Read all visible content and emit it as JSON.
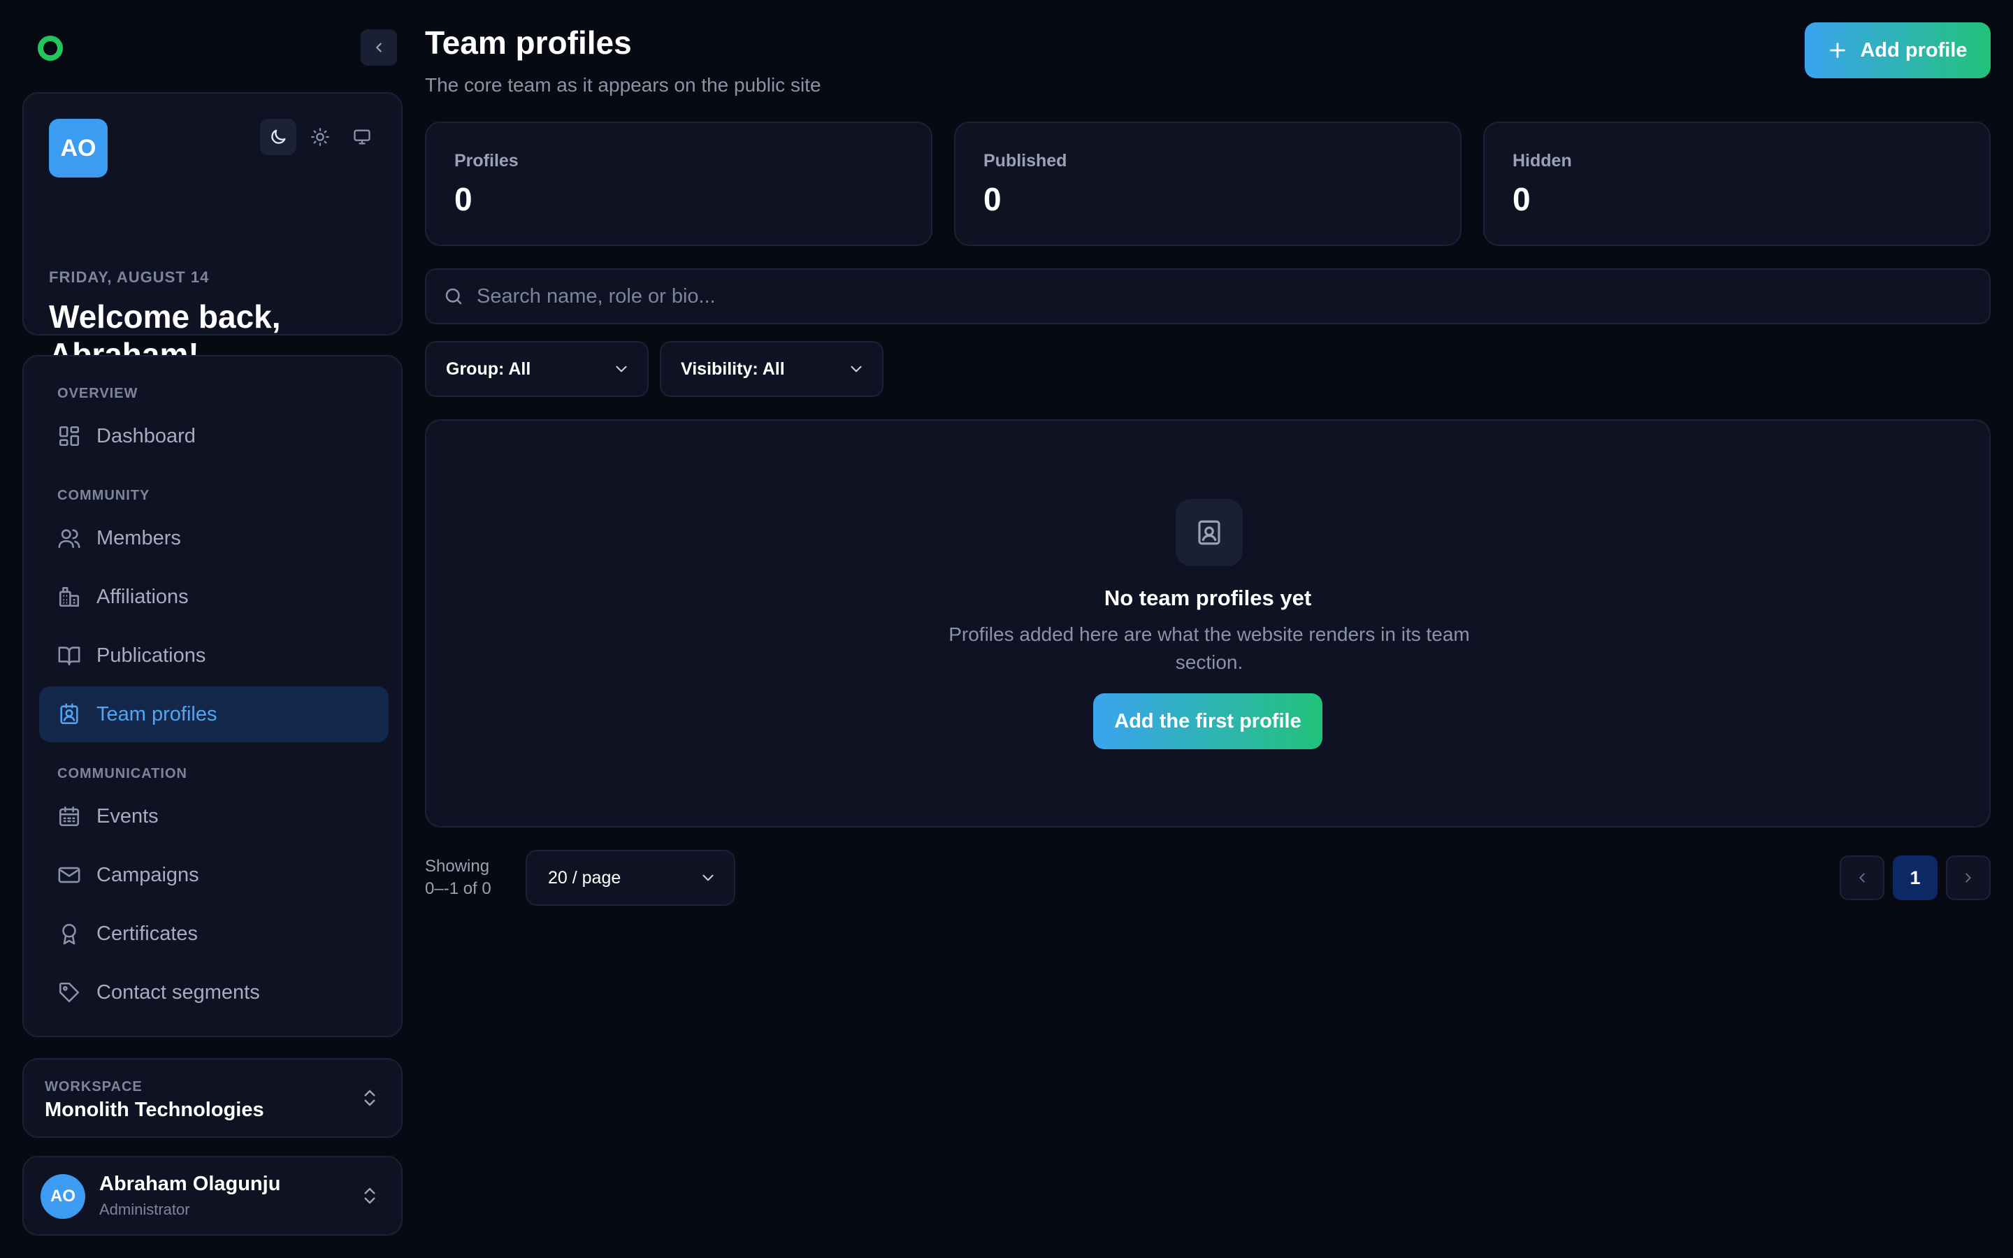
{
  "sidebar": {
    "profile": {
      "initials": "AO",
      "date": "FRIDAY, AUGUST 14",
      "greeting": "Welcome back, Abraham!"
    },
    "sections": {
      "overview": "OVERVIEW",
      "community": "COMMUNITY",
      "communication": "COMMUNICATION"
    },
    "items": {
      "dashboard": "Dashboard",
      "members": "Members",
      "affiliations": "Affiliations",
      "publications": "Publications",
      "team_profiles": "Team profiles",
      "events": "Events",
      "campaigns": "Campaigns",
      "certificates": "Certificates",
      "contact_segments": "Contact segments"
    },
    "workspace": {
      "label": "WORKSPACE",
      "name": "Monolith Technologies"
    },
    "user": {
      "initials": "AO",
      "name": "Abraham Olagunju",
      "role": "Administrator"
    }
  },
  "header": {
    "title": "Team profiles",
    "subtitle": "The core team as it appears on the public site",
    "add_button": "Add profile"
  },
  "stats": [
    {
      "label": "Profiles",
      "value": "0"
    },
    {
      "label": "Published",
      "value": "0"
    },
    {
      "label": "Hidden",
      "value": "0"
    }
  ],
  "search": {
    "placeholder": "Search name, role or bio..."
  },
  "filters": {
    "group": "Group: All",
    "visibility": "Visibility: All"
  },
  "empty_state": {
    "title": "No team profiles yet",
    "description": "Profiles added here are what the website renders in its team section.",
    "button": "Add the first profile"
  },
  "pagination": {
    "showing_line1": "Showing",
    "showing_line2": "0–-1 of 0",
    "per_page": "20 / page",
    "current_page": "1"
  },
  "colors": {
    "accent_blue": "#3b9cf2",
    "accent_green": "#22c55e",
    "active_nav_bg": "#13284a"
  }
}
